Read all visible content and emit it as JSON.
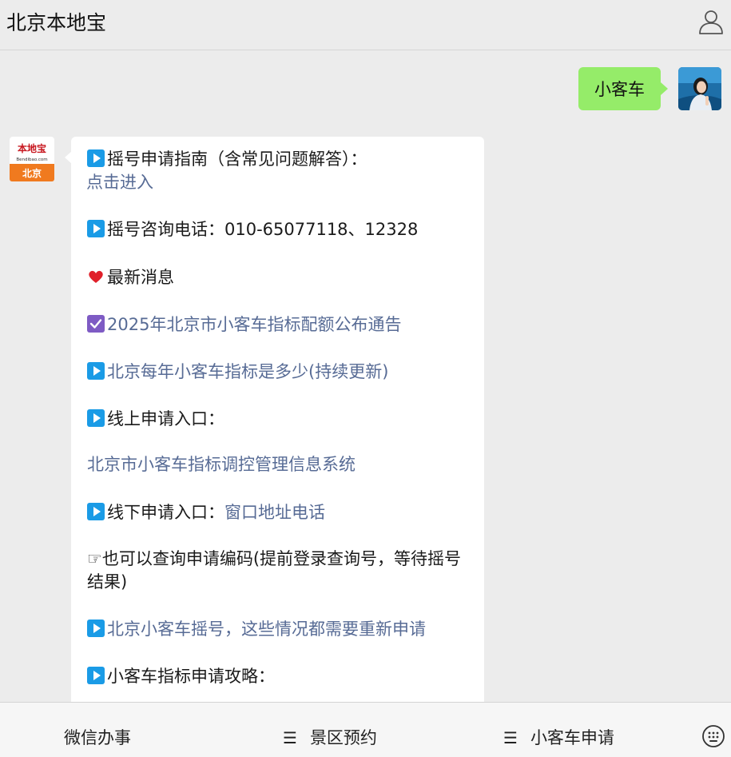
{
  "header": {
    "title": "北京本地宝",
    "profile_icon": "person-outline-icon"
  },
  "conversation": {
    "user_message": "小客车",
    "bot_avatar": {
      "top": "本地宝",
      "sub": "Bendibao.com",
      "bottom": "北京"
    },
    "reply": {
      "guide_text": "摇号申请指南（含常见问题解答）：",
      "guide_link": "点击进入",
      "hotline": "摇号咨询电话：010-65077118、12328",
      "news_heading": "最新消息",
      "quota_notice_link": "2025年北京市小客车指标配额公布通告",
      "annual_quota_link": "北京每年小客车指标是多少(持续更新)",
      "online_entry_label": "线上申请入口：",
      "online_system_link": "北京市小客车指标调控管理信息系统",
      "offline_entry_label": "线下申请入口：",
      "offline_link": "窗口地址电话",
      "query_code_text": "☞也可以查询申请编码(提前登录查询号，等待摇号结果)",
      "reapply_link": "北京小客车摇号，这些情况都需要重新申请",
      "strategy_text": "小客车指标申请攻略："
    }
  },
  "footer_menu": {
    "item1": "微信办事",
    "item2": "景区预约",
    "item3": "小客车申请",
    "menu_icon": "☰",
    "keyboard_icon": "keyboard-icon"
  },
  "colors": {
    "link": "#576b95",
    "user_bubble": "#95ec69",
    "play_icon": "#1a9be6",
    "check_icon": "#7e5bc4",
    "heart_icon": "#e0202a",
    "logo_orange": "#f07a1f"
  }
}
